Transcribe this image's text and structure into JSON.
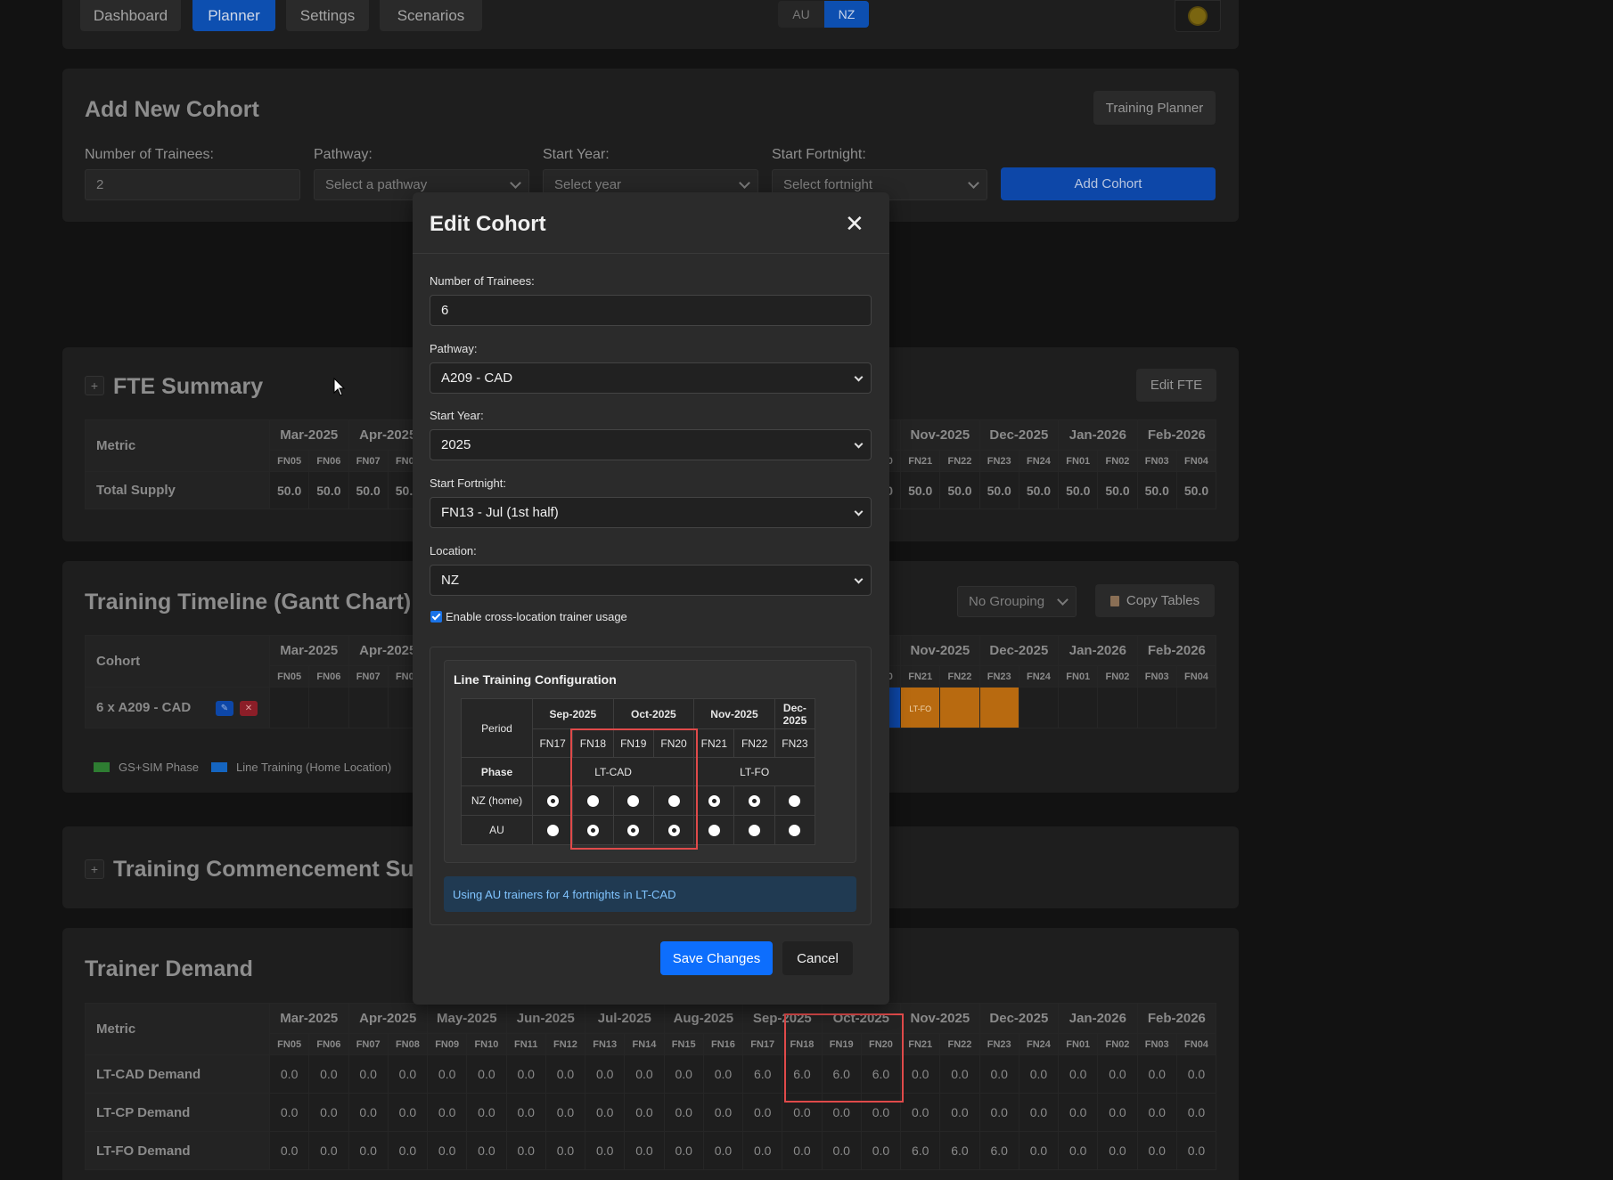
{
  "nav": {
    "tabs": [
      "Dashboard",
      "Planner",
      "Settings",
      "Scenarios"
    ],
    "active_tab": "Planner",
    "locations": [
      "AU",
      "NZ"
    ],
    "active_location": "NZ"
  },
  "add_cohort": {
    "title": "Add New Cohort",
    "training_planner_btn": "Training Planner",
    "trainees_label": "Number of Trainees:",
    "trainees_value": "2",
    "pathway_label": "Pathway:",
    "pathway_placeholder": "Select a pathway",
    "start_year_label": "Start Year:",
    "start_year_placeholder": "Select year",
    "start_fortnight_label": "Start Fortnight:",
    "start_fortnight_placeholder": "Select fortnight",
    "add_btn": "Add Cohort"
  },
  "months": [
    "Mar-2025",
    "Apr-2025",
    "May-2025",
    "Jun-2025",
    "Jul-2025",
    "Aug-2025",
    "Sep-2025",
    "Oct-2025",
    "Nov-2025",
    "Dec-2025",
    "Jan-2026",
    "Feb-2026"
  ],
  "fortnights": [
    "FN05",
    "FN06",
    "FN07",
    "FN08",
    "FN09",
    "FN10",
    "FN11",
    "FN12",
    "FN13",
    "FN14",
    "FN15",
    "FN16",
    "FN17",
    "FN18",
    "FN19",
    "FN20",
    "FN21",
    "FN22",
    "FN23",
    "FN24",
    "FN01",
    "FN02",
    "FN03",
    "FN04"
  ],
  "fte_summary": {
    "title": "FTE Summary",
    "edit_btn": "Edit FTE",
    "metric_header": "Metric",
    "rows": [
      {
        "label": "Total Supply",
        "values": [
          "50.0",
          "50.0",
          "50.0",
          "50.0",
          "50.0",
          "50.0",
          "50.0",
          "50.0",
          "50.0",
          "50.0",
          "50.0",
          "50.0",
          "50.0",
          "50.0",
          "50.0",
          "50.0",
          "50.0",
          "50.0",
          "50.0",
          "50.0",
          "50.0",
          "50.0",
          "50.0",
          "50.0"
        ]
      }
    ]
  },
  "gantt": {
    "title": "Training Timeline (Gantt Chart)",
    "grouping": "No Grouping",
    "copy_btn": "Copy Tables",
    "cohort_header": "Cohort",
    "cohort_label": "6 x A209 - CAD",
    "bar_label": "LT-FO",
    "legend": [
      {
        "label": "GS+SIM Phase",
        "color": "#2e7d32"
      },
      {
        "label": "Line Training (Home Location)",
        "color": "#1565c0"
      }
    ]
  },
  "commencement": {
    "title": "Training Commencement Summary"
  },
  "trainer_demand": {
    "title": "Trainer Demand",
    "metric_header": "Metric",
    "rows": [
      {
        "label": "LT-CAD Demand",
        "values": [
          "0.0",
          "0.0",
          "0.0",
          "0.0",
          "0.0",
          "0.0",
          "0.0",
          "0.0",
          "0.0",
          "0.0",
          "0.0",
          "0.0",
          "6.0",
          "6.0",
          "6.0",
          "6.0",
          "0.0",
          "0.0",
          "0.0",
          "0.0",
          "0.0",
          "0.0",
          "0.0",
          "0.0"
        ]
      },
      {
        "label": "LT-CP Demand",
        "values": [
          "0.0",
          "0.0",
          "0.0",
          "0.0",
          "0.0",
          "0.0",
          "0.0",
          "0.0",
          "0.0",
          "0.0",
          "0.0",
          "0.0",
          "0.0",
          "0.0",
          "0.0",
          "0.0",
          "0.0",
          "0.0",
          "0.0",
          "0.0",
          "0.0",
          "0.0",
          "0.0",
          "0.0"
        ]
      },
      {
        "label": "LT-FO Demand",
        "values": [
          "0.0",
          "0.0",
          "0.0",
          "0.0",
          "0.0",
          "0.0",
          "0.0",
          "0.0",
          "0.0",
          "0.0",
          "0.0",
          "0.0",
          "0.0",
          "0.0",
          "0.0",
          "0.0",
          "6.0",
          "6.0",
          "6.0",
          "0.0",
          "0.0",
          "0.0",
          "0.0",
          "0.0"
        ]
      }
    ]
  },
  "modal": {
    "title": "Edit Cohort",
    "close": "✕",
    "trainees_label": "Number of Trainees:",
    "trainees_value": "6",
    "pathway_label": "Pathway:",
    "pathway_value": "A209 - CAD",
    "start_year_label": "Start Year:",
    "start_year_value": "2025",
    "start_fortnight_label": "Start Fortnight:",
    "start_fortnight_value": "FN13 - Jul (1st half)",
    "location_label": "Location:",
    "location_value": "NZ",
    "cross_location_label": "Enable cross-location trainer usage",
    "cross_location_checked": true,
    "ltc": {
      "title": "Line Training Configuration",
      "period_header": "Period",
      "phase_header": "Phase",
      "months": [
        {
          "label": "Sep-2025",
          "span": 2
        },
        {
          "label": "Oct-2025",
          "span": 2
        },
        {
          "label": "Nov-2025",
          "span": 2
        },
        {
          "label": "Dec-2025",
          "span": 1
        }
      ],
      "fortnights": [
        "FN17",
        "FN18",
        "FN19",
        "FN20",
        "FN21",
        "FN22",
        "FN23"
      ],
      "phases": [
        {
          "label": "LT-CAD",
          "span": 4
        },
        {
          "label": "LT-FO",
          "span": 3
        }
      ],
      "rows": [
        {
          "label": "NZ (home)",
          "selected": [
            true,
            false,
            false,
            false,
            true,
            true,
            false
          ]
        },
        {
          "label": "AU",
          "selected": [
            false,
            true,
            true,
            true,
            false,
            false,
            false
          ]
        }
      ]
    },
    "info": "Using AU trainers for 4 fortnights in LT-CAD",
    "save_btn": "Save Changes",
    "cancel_btn": "Cancel"
  }
}
